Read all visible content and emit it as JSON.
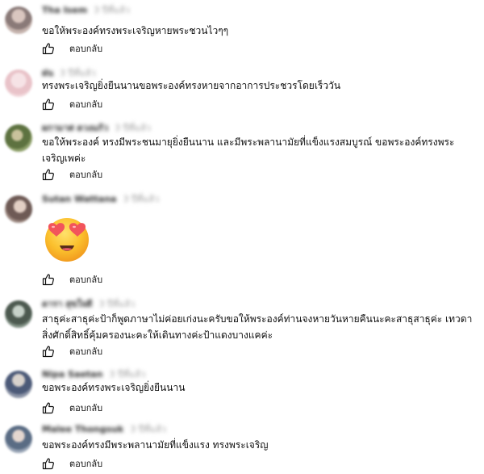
{
  "comments": [
    {
      "author": "Tha Isem",
      "time": "3 ปีที่แล้ว",
      "text": "ขอให้พระองค์ทรงพระเจริญหายพระชวนไวๆๆ",
      "reply_label": "ตอบกลับ",
      "avatar_colors": [
        "#8a7a78",
        "#c4b2ac"
      ]
    },
    {
      "author": "ฝน",
      "time": "3 ปีที่แล้ว",
      "text": "ทรงพระเจริญยิ่งยืนนานขอพระองค์ทรงหายจากอาการประชวรโดยเร็ววัน",
      "reply_label": "ตอบกลับ",
      "avatar_colors": [
        "#e9c3c9",
        "#f4dde0"
      ]
    },
    {
      "author": "ผกามาศ ดวงแก้ว",
      "time": "3 ปีที่แล้ว",
      "text": "ขอให้พระองค์ ทรงมีพระชนมายุยิ่งยืนนาน และมีพระพลานามัยที่แข็งแรงสมบูรณ์ ขอพระองค์ทรงพระเจริญเพค่ะ",
      "reply_label": "ตอบกลับ",
      "avatar_colors": [
        "#5d7240",
        "#a9b88a"
      ]
    },
    {
      "author": "Sutan Wattana",
      "time": "3 ปีที่แล้ว",
      "text": "",
      "reply_label": "ตอบกลับ",
      "avatar_colors": [
        "#6e5a55",
        "#b9a49c"
      ]
    },
    {
      "author": "ดารา สุขใจดี",
      "time": "3 ปีที่แล้ว",
      "text": "สาธุค่ะสาธุค่ะป้าก็พูดภาษาไม่ค่อยเก่งนะครับขอให้พระองค์ท่านจงหายวันหายคืนนะคะสาธุสาธุค่ะ เทวดาสิ่งศักดิ์สิทธิ์คุ้มครองนะคะให้เดินทางค่ะป้าแดงบางแคค่ะ",
      "reply_label": "ตอบกลับ",
      "avatar_colors": [
        "#4d5a50",
        "#9fb0a3"
      ]
    },
    {
      "author": "Nipa Saetan",
      "time": "3 ปีที่แล้ว",
      "text": "ขอพระองค์ทรงพระเจริญยิ่งยืนนาน",
      "reply_label": "ตอบกลับ",
      "avatar_colors": [
        "#4c5a78",
        "#a3a8b6"
      ]
    },
    {
      "author": "Malee Thongsuk",
      "time": "3 ปีที่แล้ว",
      "text": "ขอพระองค์ทรงมีพระพลานามัยที่แข็งแรง ทรงพระเจริญ",
      "reply_label": "ตอบกลับ",
      "avatar_colors": [
        "#5a6c84",
        "#b8c0cc"
      ]
    }
  ],
  "emoji_name": "heart-eyes-emoji",
  "icon_name": "thumbs-up-icon"
}
